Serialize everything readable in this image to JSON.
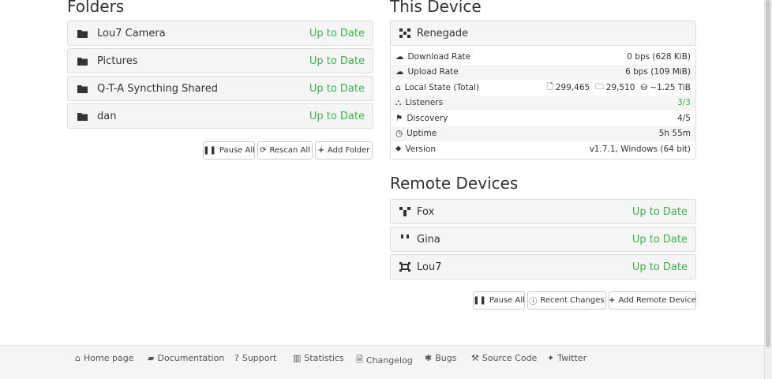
{
  "folders": {
    "title": "Folders",
    "items": [
      {
        "name": "Lou7 Camera",
        "status": "Up to Date"
      },
      {
        "name": "Pictures",
        "status": "Up to Date"
      },
      {
        "name": "Q-T-A Syncthing Shared",
        "status": "Up to Date"
      },
      {
        "name": "dan",
        "status": "Up to Date"
      }
    ],
    "buttons": {
      "pause_all": "Pause All",
      "rescan_all": "Rescan All",
      "add_folder": "Add Folder"
    }
  },
  "this_device": {
    "title": "This Device",
    "name": "Renegade",
    "rows": {
      "download": {
        "label": "Download Rate",
        "value": "0 bps (628 KiB)"
      },
      "upload": {
        "label": "Upload Rate",
        "value": "6 bps (109 MiB)"
      },
      "local_state": {
        "label": "Local State (Total)",
        "files": "299,465",
        "dirs": "29,510",
        "size": "~1.25 TiB"
      },
      "listeners": {
        "label": "Listeners",
        "value": "3/3"
      },
      "discovery": {
        "label": "Discovery",
        "value": "4/5"
      },
      "uptime": {
        "label": "Uptime",
        "value": "5h 55m"
      },
      "version": {
        "label": "Version",
        "value": "v1.7.1, Windows (64 bit)"
      }
    }
  },
  "remote_devices": {
    "title": "Remote Devices",
    "items": [
      {
        "name": "Fox",
        "status": "Up to Date"
      },
      {
        "name": "Gina",
        "status": "Up to Date"
      },
      {
        "name": "Lou7",
        "status": "Up to Date"
      }
    ],
    "buttons": {
      "pause_all": "Pause All",
      "recent_changes": "Recent Changes",
      "add_remote": "Add Remote Device"
    }
  },
  "footer": {
    "home": "Home page",
    "docs": "Documentation",
    "support": "Support",
    "stats": "Statistics",
    "changelog": "Changelog",
    "bugs": "Bugs",
    "source": "Source Code",
    "twitter": "Twitter"
  },
  "colors": {
    "status_green": "#3cb44b",
    "panel_bg": "#f5f5f5",
    "border": "#dddddd"
  }
}
